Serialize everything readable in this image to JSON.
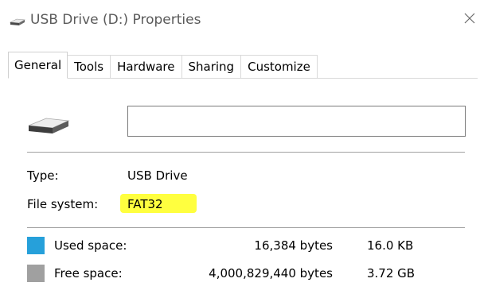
{
  "window": {
    "title": "USB Drive (D:) Properties"
  },
  "tabs": [
    {
      "label": "General",
      "active": true
    },
    {
      "label": "Tools",
      "active": false
    },
    {
      "label": "Hardware",
      "active": false
    },
    {
      "label": "Sharing",
      "active": false
    },
    {
      "label": "Customize",
      "active": false
    }
  ],
  "drive": {
    "name_value": "",
    "icon": "usb-drive-icon"
  },
  "properties": {
    "type_label": "Type:",
    "type_value": "USB Drive",
    "fs_label": "File system:",
    "fs_value": "FAT32",
    "fs_highlight_color": "#ffff3f"
  },
  "space": {
    "used": {
      "label": "Used space:",
      "bytes": "16,384 bytes",
      "size": "16.0 KB",
      "color": "#26a0da"
    },
    "free": {
      "label": "Free space:",
      "bytes": "4,000,829,440 bytes",
      "size": "3.72 GB",
      "color": "#a0a0a0"
    }
  },
  "icons": {
    "title": "usb-drive-icon",
    "close": "close-icon"
  }
}
